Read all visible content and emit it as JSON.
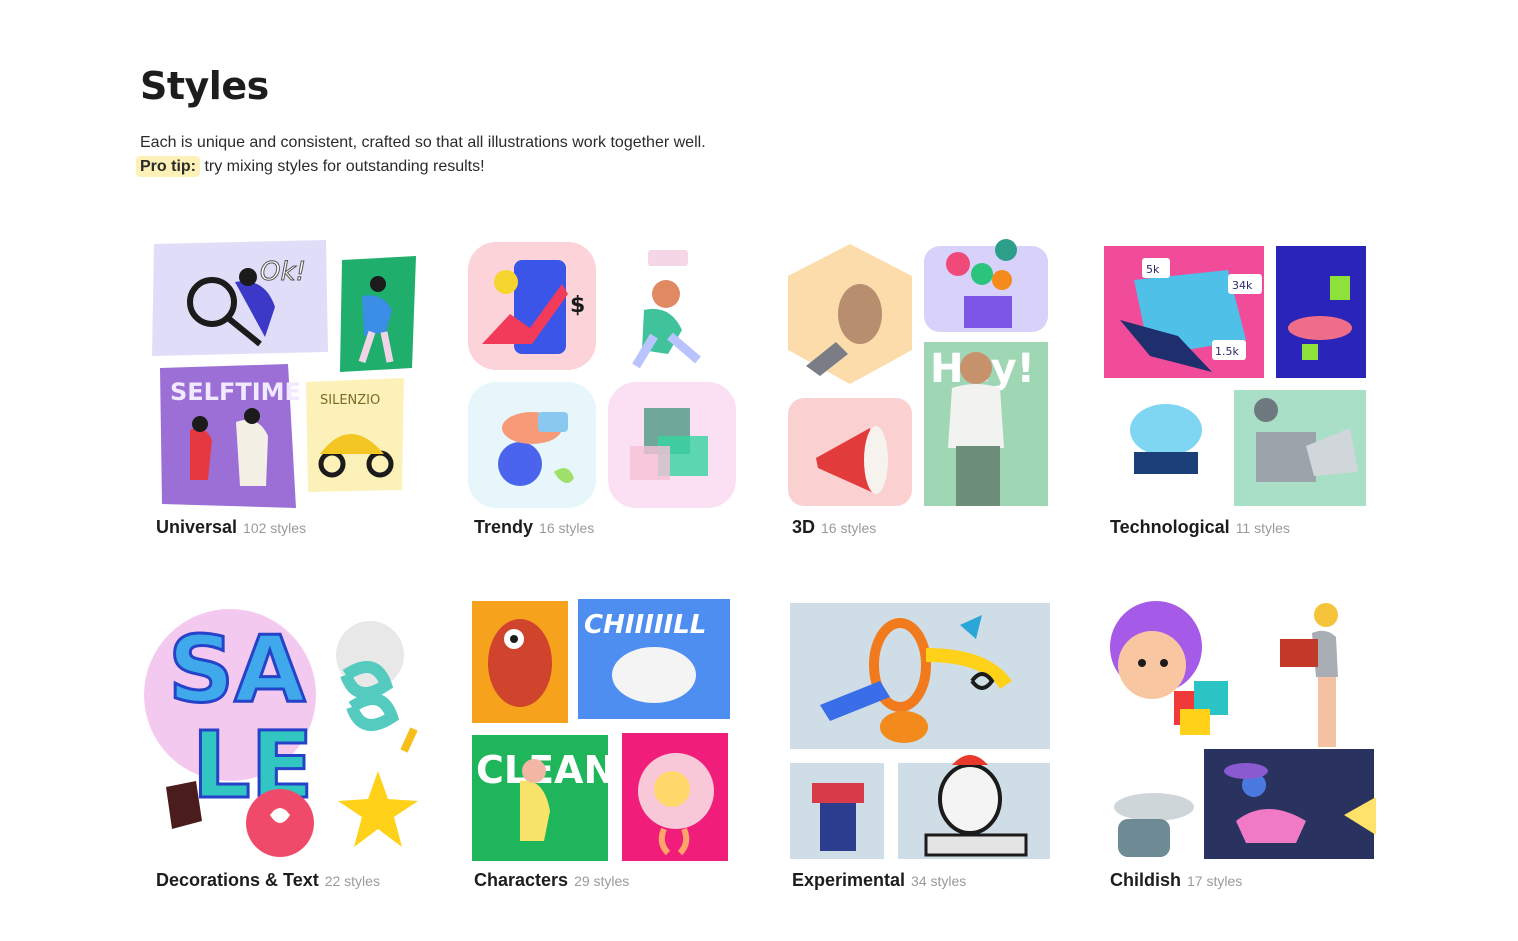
{
  "page": {
    "title": "Styles",
    "description": "Each is unique and consistent, crafted so that all illustrations work together well.",
    "tip_label": "Pro tip:",
    "tip_text": " try mixing styles for outstanding results!"
  },
  "categories": [
    {
      "name": "Universal",
      "count": "102 styles",
      "thumbs": {
        "ok": "Ok!",
        "selftime": "SELFTIME",
        "silenzio": "SILENZIO"
      }
    },
    {
      "name": "Trendy",
      "count": "16 styles",
      "thumbs": {
        "dollar": "$"
      }
    },
    {
      "name": "3D",
      "count": "16 styles",
      "thumbs": {
        "hey": "Hey!"
      }
    },
    {
      "name": "Technological",
      "count": "11 styles",
      "thumbs": {
        "stat_a": "5k",
        "stat_b": "34k",
        "stat_c": "1.5k"
      }
    },
    {
      "name": "Decorations & Text",
      "count": "22 styles",
      "thumbs": {
        "sa": "SA",
        "le": "LE"
      }
    },
    {
      "name": "Characters",
      "count": "29 styles",
      "thumbs": {
        "chill": "CHIIIIILL",
        "clean": "CLEAN"
      }
    },
    {
      "name": "Experimental",
      "count": "34 styles",
      "thumbs": {}
    },
    {
      "name": "Childish",
      "count": "17 styles",
      "thumbs": {}
    }
  ],
  "colors": {
    "tip_highlight": "#fdf1b8",
    "text": "#1d1d1f",
    "muted": "#9a9a9a"
  }
}
